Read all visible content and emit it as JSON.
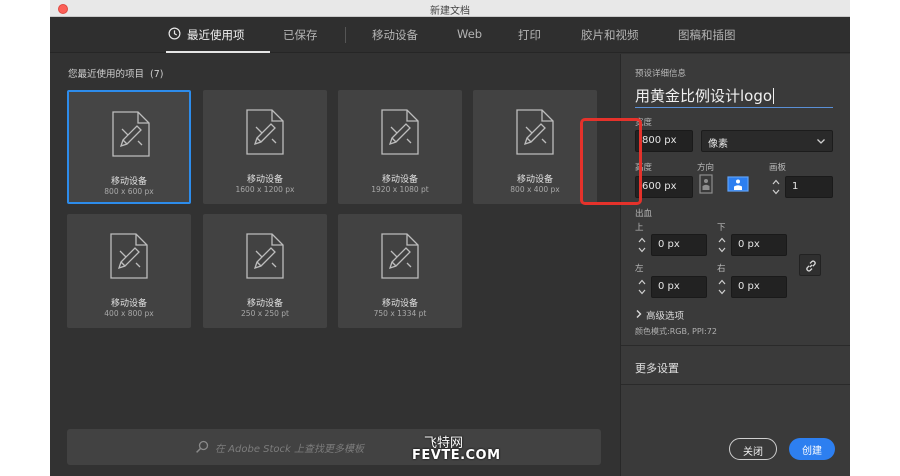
{
  "window": {
    "title": "新建文档"
  },
  "tabs": [
    {
      "label": "最近使用项",
      "active": true
    },
    {
      "label": "已保存"
    },
    {
      "label": "移动设备"
    },
    {
      "label": "Web"
    },
    {
      "label": "打印"
    },
    {
      "label": "胶片和视频"
    },
    {
      "label": "图稿和插图"
    }
  ],
  "recent": {
    "title": "您最近使用的项目",
    "count": "(7)",
    "items": [
      {
        "name": "移动设备",
        "size": "800 x 600 px",
        "selected": true
      },
      {
        "name": "移动设备",
        "size": "1600 x 1200 px"
      },
      {
        "name": "移动设备",
        "size": "1920 x 1080 pt"
      },
      {
        "name": "移动设备",
        "size": "800 x 400 px"
      },
      {
        "name": "移动设备",
        "size": "400 x 800 px"
      },
      {
        "name": "移动设备",
        "size": "250 x 250 pt"
      },
      {
        "name": "移动设备",
        "size": "750 x 1334 pt"
      }
    ]
  },
  "stock": {
    "placeholder": "在 Adobe Stock 上查找更多模板"
  },
  "details": {
    "title": "预设详细信息",
    "doc_name": "用黄金比例设计logo",
    "width_label": "宽度",
    "width_value": "800 px",
    "unit": "像素",
    "height_label": "高度",
    "height_value": "600 px",
    "orientation_label": "方向",
    "artboards_label": "画板",
    "artboards_value": "1",
    "bleed_label": "出血",
    "bleed": {
      "top_label": "上",
      "top": "0 px",
      "bottom_label": "下",
      "bottom": "0 px",
      "left_label": "左",
      "left": "0 px",
      "right_label": "右",
      "right": "0 px"
    },
    "advanced_label": "高级选项",
    "color_mode": "颜色模式:RGB, PPI:72",
    "more_settings": "更多设置",
    "close_button": "关闭",
    "create_button": "创建"
  },
  "watermark": {
    "line1": "飞特网",
    "line2": "FEVTE.COM"
  },
  "colors": {
    "accent": "#2d7ff0",
    "highlight": "#e5322b",
    "panel": "#3a3a3a",
    "background": "#323232"
  },
  "icons": [
    "clock-icon",
    "document-pencil-icon",
    "search-icon",
    "chevron-down-icon",
    "portrait-icon",
    "landscape-icon",
    "link-icon",
    "chevron-right-icon",
    "spinner-arrows-icon"
  ]
}
